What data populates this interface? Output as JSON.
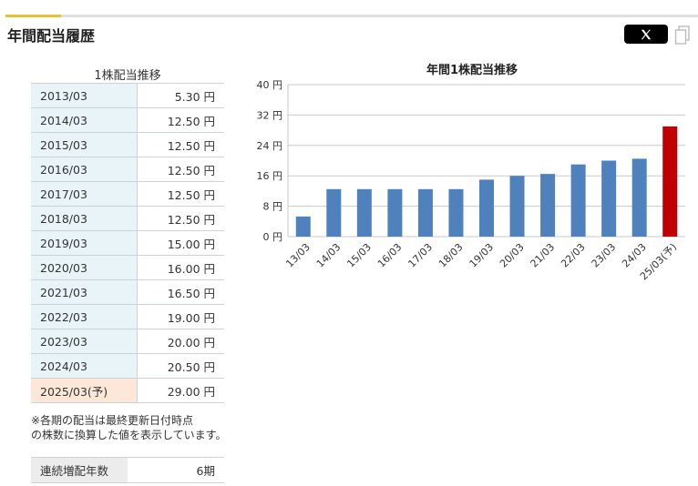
{
  "section_title": "年間配当履歴",
  "table": {
    "caption": "1株配当推移",
    "rows": [
      {
        "period": "2013/03",
        "amount": "5.30 円"
      },
      {
        "period": "2014/03",
        "amount": "12.50 円"
      },
      {
        "period": "2015/03",
        "amount": "12.50 円"
      },
      {
        "period": "2016/03",
        "amount": "12.50 円"
      },
      {
        "period": "2017/03",
        "amount": "12.50 円"
      },
      {
        "period": "2018/03",
        "amount": "12.50 円"
      },
      {
        "period": "2019/03",
        "amount": "15.00 円"
      },
      {
        "period": "2020/03",
        "amount": "16.00 円"
      },
      {
        "period": "2021/03",
        "amount": "16.50 円"
      },
      {
        "period": "2022/03",
        "amount": "19.00 円"
      },
      {
        "period": "2023/03",
        "amount": "20.00 円"
      },
      {
        "period": "2024/03",
        "amount": "20.50 円"
      },
      {
        "period": "2025/03(予)",
        "amount": "29.00 円",
        "forecast": true
      }
    ]
  },
  "note": "※各期の配当は最終更新日付時点\nの株数に換算した値を表示しています。",
  "streak": {
    "label": "連続増配年数",
    "value": "6期"
  },
  "colors": {
    "bar": "#4f81bd",
    "forecast_bar": "#c00000",
    "accent": "#e3c23a",
    "period_bg": "#e8f4f7",
    "forecast_bg": "#fde7d8"
  },
  "icons": {
    "share": "x-logo-icon",
    "copy": "copy-icon"
  },
  "chart_data": {
    "type": "bar",
    "title": "年間1株配当推移",
    "categories": [
      "13/03",
      "14/03",
      "15/03",
      "16/03",
      "17/03",
      "18/03",
      "19/03",
      "20/03",
      "21/03",
      "22/03",
      "23/03",
      "24/03",
      "25/03(予)"
    ],
    "values": [
      5.3,
      12.5,
      12.5,
      12.5,
      12.5,
      12.5,
      15.0,
      16.0,
      16.5,
      19.0,
      20.0,
      20.5,
      29.0
    ],
    "forecast_index": 12,
    "yticks": [
      0,
      8,
      16,
      24,
      32,
      40
    ],
    "ytick_labels": [
      "0 円",
      "8 円",
      "16 円",
      "24 円",
      "32 円",
      "40 円"
    ],
    "ylim": [
      0,
      40
    ],
    "grid": true,
    "xlabel": "",
    "ylabel": ""
  }
}
